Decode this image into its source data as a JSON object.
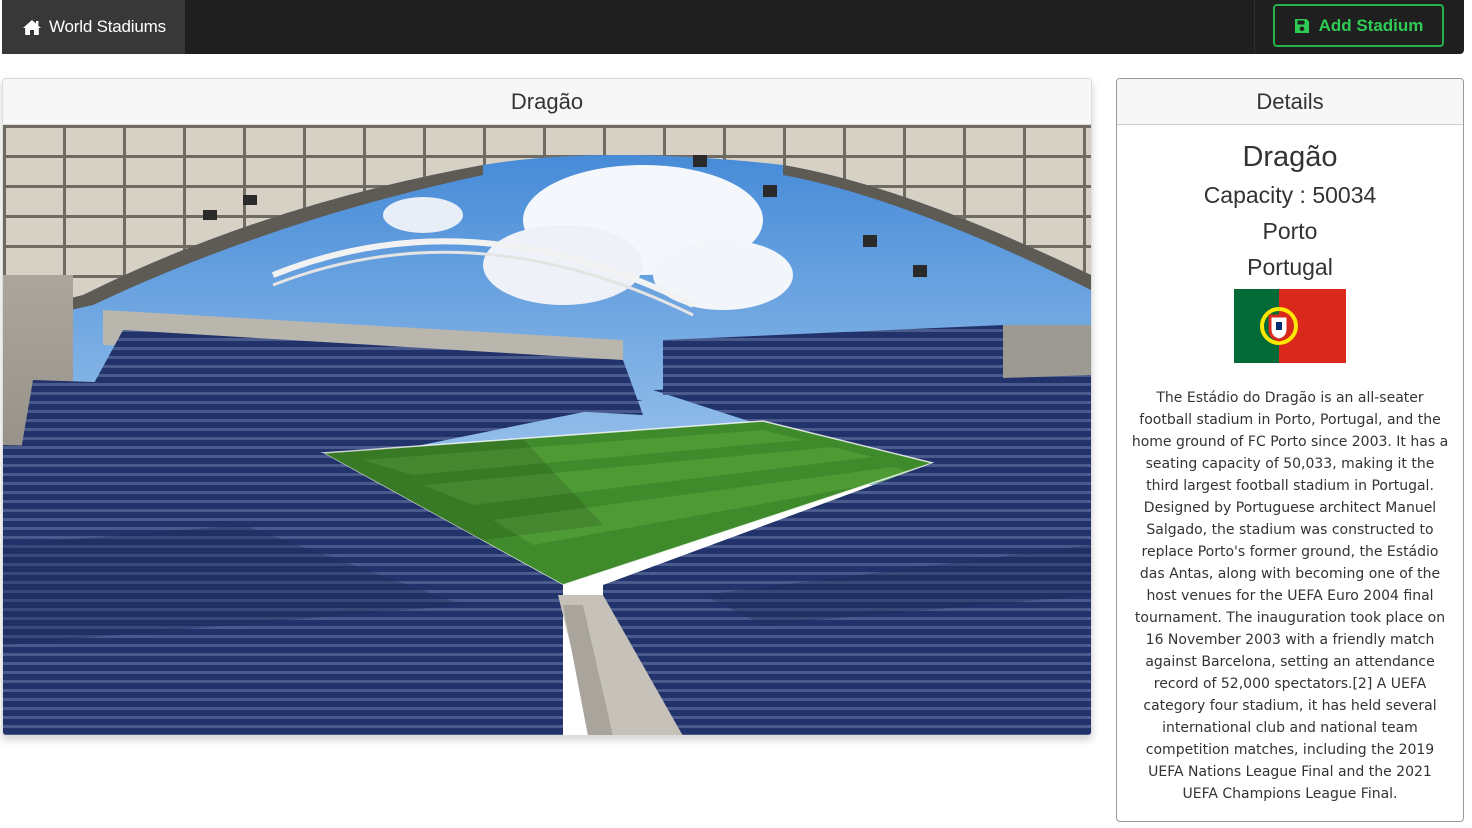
{
  "navbar": {
    "brand_label": "World Stadiums",
    "brand_icon": "home-icon",
    "add_label": "Add Stadium",
    "add_icon": "save-icon"
  },
  "main": {
    "title": "Dragão",
    "image_alt": "stadium-photo"
  },
  "details": {
    "header": "Details",
    "name": "Dragão",
    "capacity": "Capacity : 50034",
    "city": "Porto",
    "country": "Portugal",
    "flag": "portugal-flag",
    "description": "The Estádio do Dragão is an all-seater football stadium in Porto, Portugal, and the home ground of FC Porto since 2003. It has a seating capacity of 50,033, making it the third largest football stadium in Portugal. Designed by Portuguese architect Manuel Salgado, the stadium was constructed to replace Porto's former ground, the Estádio das Antas, along with becoming one of the host venues for the UEFA Euro 2004 final tournament. The inauguration took place on 16 November 2003 with a friendly match against Barcelona, setting an attendance record of 52,000 spectators.[2] A UEFA category four stadium, it has held several international club and national team competition matches, including the 2019 UEFA Nations League Final and the 2021 UEFA Champions League Final."
  },
  "colors": {
    "navbar_bg": "#1f1f1f",
    "accent_green": "#28b14a",
    "flag_green": "#046a38",
    "flag_red": "#da291c"
  }
}
